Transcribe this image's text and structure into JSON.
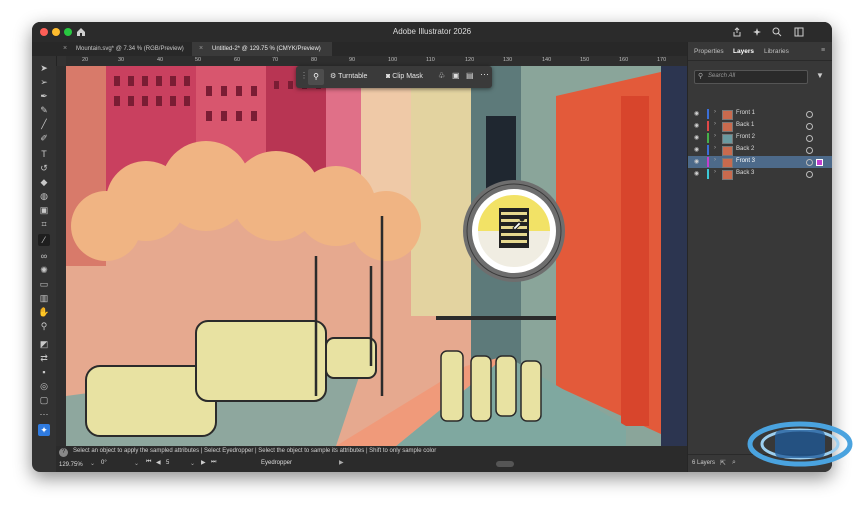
{
  "window": {
    "title": "Adobe Illustrator 2026",
    "doc_tabs": [
      {
        "label": "Mountain.svg* @ 7.34 % (RGB/Preview)"
      },
      {
        "label": "Untitled-2* @ 129.75 % (CMYK/Preview)"
      }
    ]
  },
  "ruler": {
    "h_ticks": [
      "20",
      "30",
      "40",
      "50",
      "60",
      "70",
      "80",
      "90",
      "100",
      "110",
      "120",
      "130",
      "140",
      "150",
      "160",
      "170"
    ]
  },
  "context_bar": {
    "turntable": "Turntable",
    "clip_mask": "Clip Mask"
  },
  "status": {
    "help": "Select an object to apply the sampled attributes  |  Select Eyedropper  |  Select the object to sample its attributes  |  Shift to only sample color",
    "zoom": "129.75%",
    "rotation": "0°",
    "artboard": "5",
    "tool": "Eyedropper"
  },
  "panel": {
    "tabs": [
      "Properties",
      "Layers",
      "Libraries"
    ],
    "search_placeholder": "Search All",
    "layers": [
      {
        "name": "Front 1",
        "color": "#3b6fd6"
      },
      {
        "name": "Back 1",
        "color": "#e04848"
      },
      {
        "name": "Front 2",
        "color": "#46b04a"
      },
      {
        "name": "Back 2",
        "color": "#3b6fd6"
      },
      {
        "name": "Front 3",
        "color": "#c23fd0",
        "selected": true
      },
      {
        "name": "Back 3",
        "color": "#3bc8d6"
      }
    ],
    "count": "6 Layers"
  },
  "colors": {
    "accent": "#2f7be0",
    "selection": "#4d6a8a"
  }
}
